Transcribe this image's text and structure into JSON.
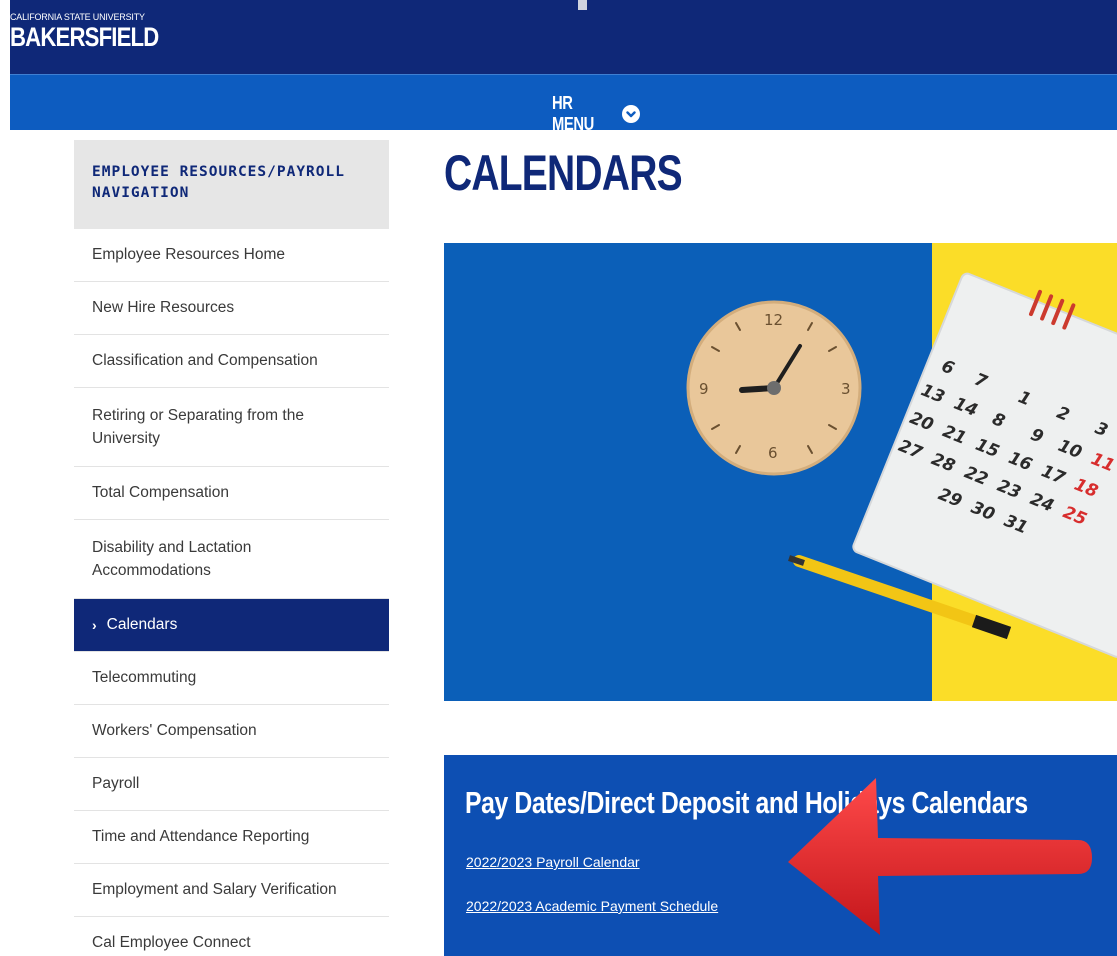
{
  "header": {
    "brand_top": "California State University",
    "brand_main": "BAKERSFIELD"
  },
  "menu": {
    "label": "HR MENU",
    "icon": "chevron-down-circle-icon"
  },
  "sidebar": {
    "heading_line1": "EMPLOYEE RESOURCES/PAYROLL",
    "heading_line2": "NAVIGATION",
    "items": [
      {
        "label": "Employee Resources Home"
      },
      {
        "label": "New Hire Resources"
      },
      {
        "label": "Classification and Compensation"
      },
      {
        "label": "Retiring or Separating from the University"
      },
      {
        "label": "Total Compensation"
      },
      {
        "label": "Disability and Lactation Accommodations"
      },
      {
        "label": "Calendars",
        "active": true
      },
      {
        "label": "Telecommuting"
      },
      {
        "label": "Workers' Compensation"
      },
      {
        "label": "Payroll"
      },
      {
        "label": "Time and Attendance Reporting"
      },
      {
        "label": "Employment and Salary Verification"
      },
      {
        "label": "Cal Employee Connect"
      }
    ]
  },
  "main": {
    "title": "CALENDARS",
    "hero": {
      "calendar_rows": [
        [
          "6",
          "7",
          "1",
          "2",
          "3"
        ],
        [
          "13",
          "14",
          "8",
          "9",
          "10",
          "11"
        ],
        [
          "20",
          "21",
          "15",
          "16",
          "17",
          "18"
        ],
        [
          "27",
          "28",
          "22",
          "23",
          "24",
          "25"
        ],
        [
          "29",
          "30",
          "31"
        ]
      ],
      "clock_numbers": [
        "12",
        "3",
        "6",
        "9"
      ]
    },
    "panel": {
      "title": "Pay Dates/Direct Deposit and Holidays Calendars",
      "links": [
        "2022/2023 Payroll Calendar",
        "2022/2023 Academic Payment Schedule"
      ]
    }
  },
  "colors": {
    "navy": "#0f2878",
    "blue": "#0d5cc0",
    "yellow": "#fbdd28",
    "arrow_red": "#e0262a"
  }
}
